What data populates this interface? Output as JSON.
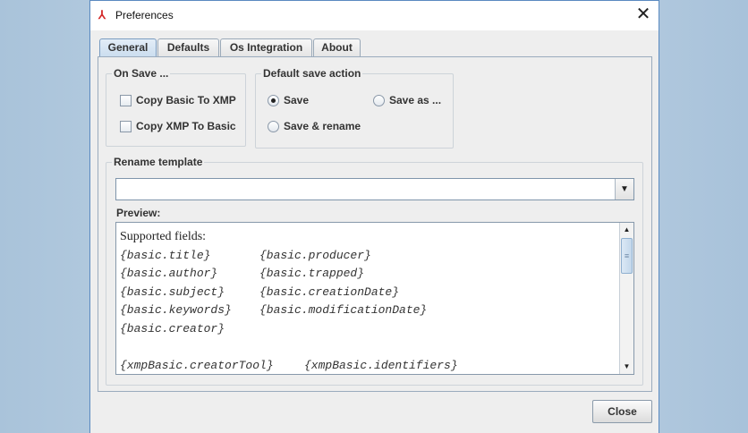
{
  "window": {
    "title": "Preferences",
    "close_glyph": "✕"
  },
  "tabs": [
    {
      "label": "General",
      "active": true
    },
    {
      "label": "Defaults"
    },
    {
      "label": "Os Integration"
    },
    {
      "label": "About"
    }
  ],
  "on_save": {
    "title": "On Save ...",
    "options": [
      {
        "label": "Copy Basic To XMP",
        "checked": false
      },
      {
        "label": "Copy XMP To Basic",
        "checked": false
      }
    ]
  },
  "default_save_action": {
    "title": "Default save action",
    "options": [
      {
        "label": "Save",
        "selected": true
      },
      {
        "label": "Save as ...",
        "selected": false
      },
      {
        "label": "Save & rename",
        "selected": false
      }
    ]
  },
  "rename_template": {
    "title": "Rename template",
    "value": "",
    "preview_label": "Preview:"
  },
  "preview": {
    "heading": "Supported fields:",
    "rows": [
      [
        "{basic.title}",
        "{basic.producer}"
      ],
      [
        "{basic.author}",
        "{basic.trapped}"
      ],
      [
        "{basic.subject}",
        "{basic.creationDate}"
      ],
      [
        "{basic.keywords}",
        "{basic.modificationDate}"
      ],
      [
        "{basic.creator}",
        ""
      ]
    ],
    "xmp_row": [
      "{xmpBasic.creatorTool}",
      "{xmpBasic.identifiers}"
    ]
  },
  "footer": {
    "close_label": "Close"
  }
}
